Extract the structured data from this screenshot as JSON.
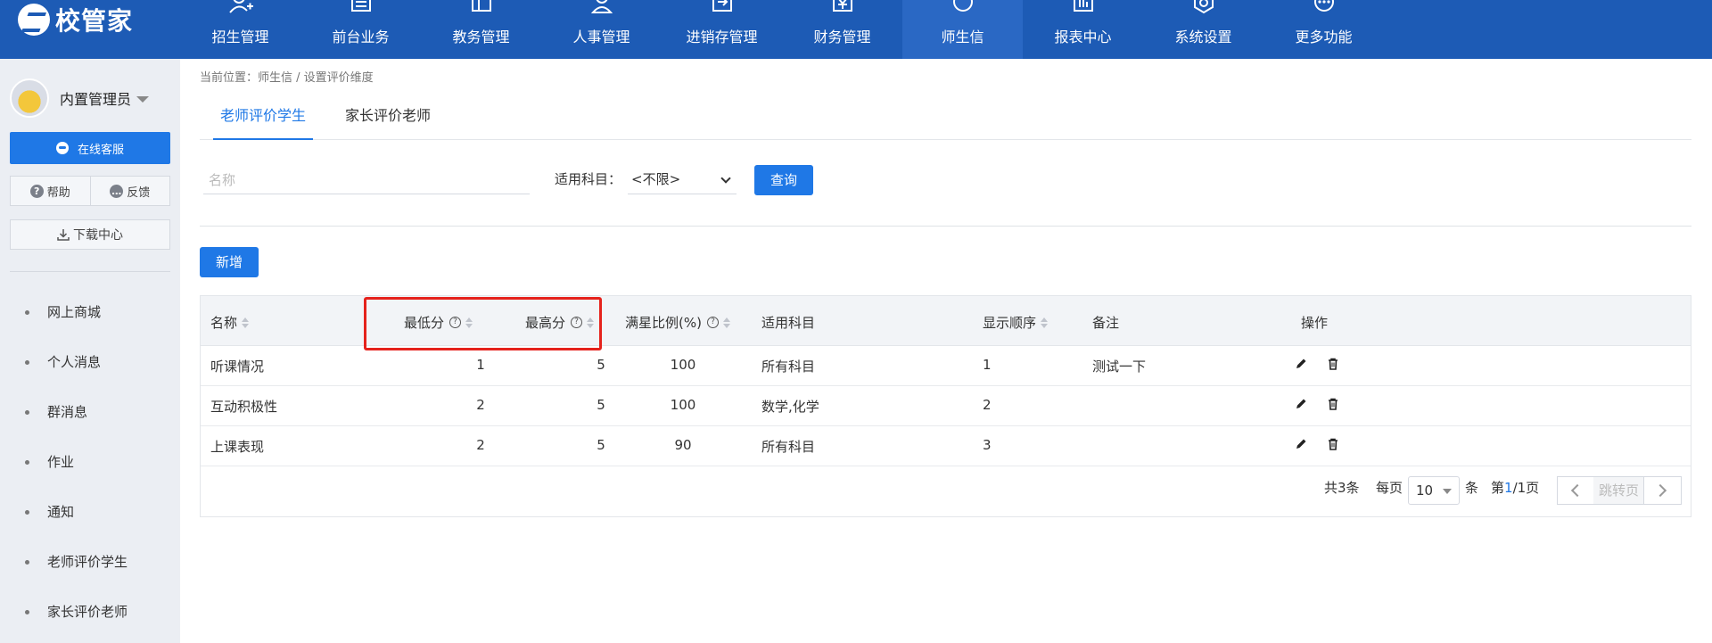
{
  "app": {
    "name": "校管家"
  },
  "nav": [
    {
      "label": "招生管理",
      "icon": "user-plus-icon"
    },
    {
      "label": "前台业务",
      "icon": "desk-icon"
    },
    {
      "label": "教务管理",
      "icon": "book-icon"
    },
    {
      "label": "人事管理",
      "icon": "person-icon"
    },
    {
      "label": "进销存管理",
      "icon": "inventory-icon"
    },
    {
      "label": "财务管理",
      "icon": "finance-icon"
    },
    {
      "label": "师生信",
      "icon": "message-icon",
      "active": true
    },
    {
      "label": "报表中心",
      "icon": "report-icon"
    },
    {
      "label": "系统设置",
      "icon": "settings-icon"
    },
    {
      "label": "更多功能",
      "icon": "more-icon"
    }
  ],
  "sidebar": {
    "user_name": "内置管理员",
    "service_label": "在线客服",
    "help_label": "帮助",
    "feedback_label": "反馈",
    "download_label": "下载中心",
    "menu": [
      "网上商城",
      "个人消息",
      "群消息",
      "作业",
      "通知",
      "老师评价学生",
      "家长评价老师"
    ]
  },
  "breadcrumb": "当前位置：师生信 / 设置评价维度",
  "tabs": [
    {
      "label": "老师评价学生",
      "active": true
    },
    {
      "label": "家长评价老师",
      "active": false
    }
  ],
  "filter": {
    "name_placeholder": "名称",
    "subject_label": "适用科目：",
    "subject_value": "<不限>",
    "query_label": "查询"
  },
  "add_label": "新增",
  "table": {
    "columns": [
      "名称",
      "最低分",
      "最高分",
      "满星比例(%)",
      "适用科目",
      "显示顺序",
      "备注",
      "操作"
    ],
    "rows": [
      {
        "name": "听课情况",
        "min": "1",
        "max": "5",
        "ratio": "100",
        "subject": "所有科目",
        "order": "1",
        "note": "测试一下"
      },
      {
        "name": "互动积极性",
        "min": "2",
        "max": "5",
        "ratio": "100",
        "subject": "数学,化学",
        "order": "2",
        "note": ""
      },
      {
        "name": "上课表现",
        "min": "2",
        "max": "5",
        "ratio": "90",
        "subject": "所有科目",
        "order": "3",
        "note": ""
      }
    ]
  },
  "pagination": {
    "total_text": "共3条",
    "per_page_label": "每页",
    "per_page_value": "10",
    "unit_label": "条",
    "page_prefix": "第",
    "current_page": "1",
    "page_suffix": "/1页",
    "jump_label": "跳转页"
  },
  "colors": {
    "primary": "#1f78e6",
    "topbar": "#1d5bb5",
    "highlight": "#e5221c"
  }
}
